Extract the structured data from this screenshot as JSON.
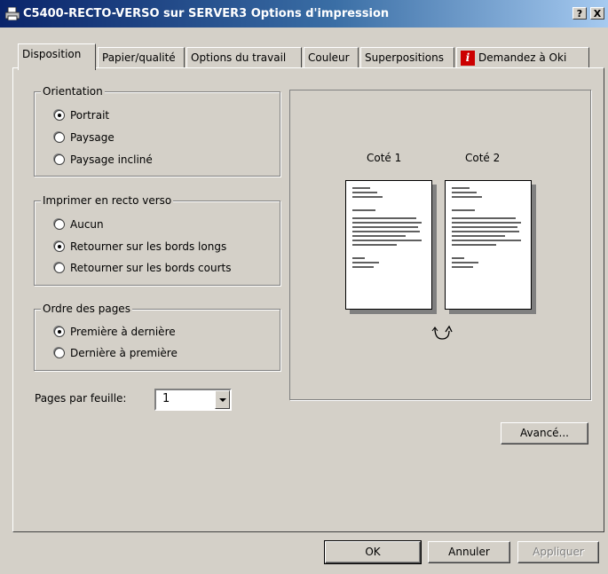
{
  "window": {
    "title": "C5400-RECTO-VERSO sur SERVER3 Options d'impression",
    "help_button": "?",
    "close_button": "X"
  },
  "tabs": [
    {
      "label": "Disposition",
      "active": true
    },
    {
      "label": "Papier/qualité"
    },
    {
      "label": "Options du travail"
    },
    {
      "label": "Couleur"
    },
    {
      "label": "Superpositions"
    },
    {
      "label": "Demandez à Oki",
      "icon": "info-icon"
    }
  ],
  "orientation": {
    "label": "Orientation",
    "options": [
      {
        "label": "Portrait",
        "checked": true
      },
      {
        "label": "Paysage",
        "checked": false
      },
      {
        "label": "Paysage incliné",
        "checked": false
      }
    ]
  },
  "duplex": {
    "label": "Imprimer en recto verso",
    "options": [
      {
        "label": "Aucun",
        "checked": false
      },
      {
        "label": "Retourner sur les bords longs",
        "checked": true
      },
      {
        "label": "Retourner sur les bords courts",
        "checked": false
      }
    ]
  },
  "page_order": {
    "label": "Ordre des pages",
    "options": [
      {
        "label": "Première à dernière",
        "checked": true
      },
      {
        "label": "Dernière à première",
        "checked": false
      }
    ]
  },
  "pages_per_sheet": {
    "label": "Pages par feuille:",
    "value": "1"
  },
  "preview": {
    "side1": "Coté 1",
    "side2": "Coté 2",
    "flip_icon": "rotate-icon"
  },
  "buttons": {
    "advanced": "Avancé...",
    "ok": "OK",
    "cancel": "Annuler",
    "apply": "Appliquer"
  },
  "colors": {
    "title_start": "#0a246a",
    "title_end": "#a6caf0",
    "info_red": "#cc0000"
  }
}
